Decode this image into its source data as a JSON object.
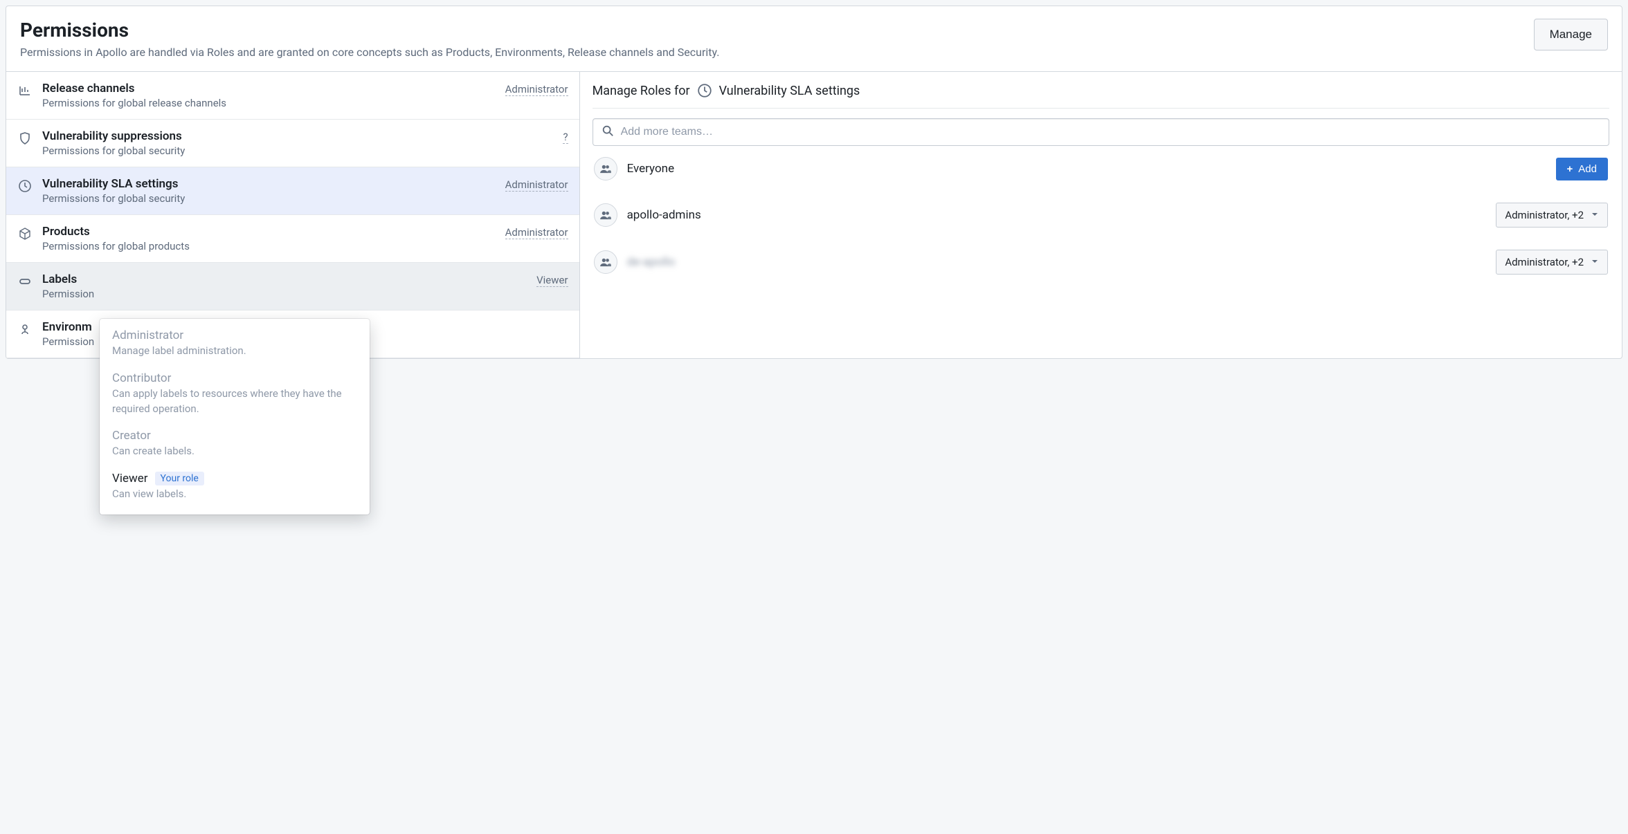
{
  "header": {
    "title": "Permissions",
    "subtitle": "Permissions in Apollo are handled via Roles and are granted on core concepts such as Products, Environments, Release channels and Security.",
    "manage_button": "Manage"
  },
  "sidebar": {
    "items": [
      {
        "title": "Release channels",
        "desc": "Permissions for global release channels",
        "badge": "Administrator"
      },
      {
        "title": "Vulnerability suppressions",
        "desc": "Permissions for global security",
        "badge": "?"
      },
      {
        "title": "Vulnerability SLA settings",
        "desc": "Permissions for global security",
        "badge": "Administrator"
      },
      {
        "title": "Products",
        "desc": "Permissions for global products",
        "badge": "Administrator"
      },
      {
        "title": "Labels",
        "desc": "Permission",
        "badge": "Viewer"
      },
      {
        "title": "Environm",
        "desc": "Permission",
        "badge": ""
      }
    ]
  },
  "main": {
    "header_label": "Manage Roles for",
    "header_title": "Vulnerability SLA settings",
    "search_placeholder": "Add more teams…",
    "teams": [
      {
        "name": "Everyone",
        "action_label": "Add"
      },
      {
        "name": "apollo-admins",
        "role_label": "Administrator, +2"
      },
      {
        "name": "de-apollo",
        "role_label": "Administrator, +2"
      }
    ]
  },
  "popover": {
    "items": [
      {
        "title": "Administrator",
        "desc": "Manage label administration."
      },
      {
        "title": "Contributor",
        "desc": "Can apply labels to resources where they have the required operation."
      },
      {
        "title": "Creator",
        "desc": "Can create labels."
      },
      {
        "title": "Viewer",
        "desc": "Can view labels.",
        "your_role_tag": "Your role"
      }
    ]
  }
}
